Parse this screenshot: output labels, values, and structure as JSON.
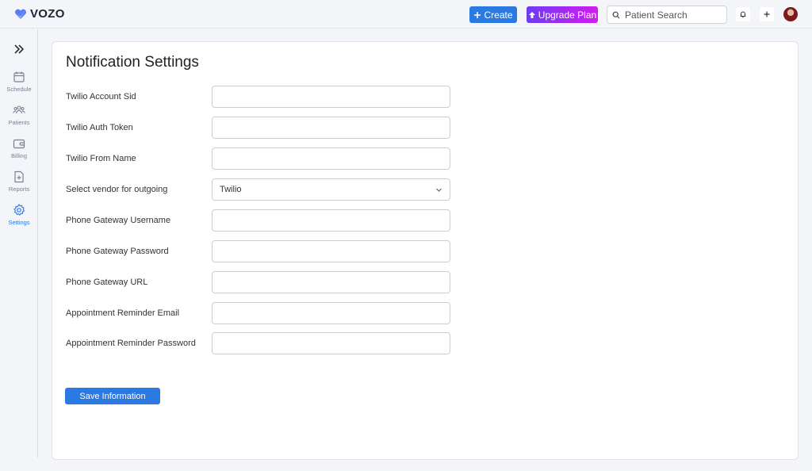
{
  "header": {
    "logo_text": "VOZO",
    "create_label": "Create",
    "upgrade_label": "Upgrade Plan",
    "search_placeholder": "Patient Search",
    "brand_color": "#2a7ae2"
  },
  "sidebar": {
    "items": [
      {
        "label": "Schedule",
        "icon": "calendar-icon"
      },
      {
        "label": "Patients",
        "icon": "users-icon"
      },
      {
        "label": "Billing",
        "icon": "wallet-icon"
      },
      {
        "label": "Reports",
        "icon": "report-icon"
      },
      {
        "label": "Settings",
        "icon": "gear-icon",
        "active": true
      }
    ]
  },
  "main": {
    "title": "Notification Settings",
    "fields": [
      {
        "label": "Twilio Account Sid",
        "value": ""
      },
      {
        "label": "Twilio Auth Token",
        "value": ""
      },
      {
        "label": "Twilio From Name",
        "value": ""
      },
      {
        "label": "Select vendor for outgoing",
        "value": "Twilio",
        "type": "select"
      },
      {
        "label": "Phone Gateway Username",
        "value": ""
      },
      {
        "label": "Phone Gateway Password",
        "value": ""
      },
      {
        "label": "Phone Gateway URL",
        "value": ""
      },
      {
        "label": "Appointment Reminder Email",
        "value": ""
      },
      {
        "label": "Appointment Reminder Password",
        "value": ""
      }
    ],
    "save_label": "Save Information"
  }
}
